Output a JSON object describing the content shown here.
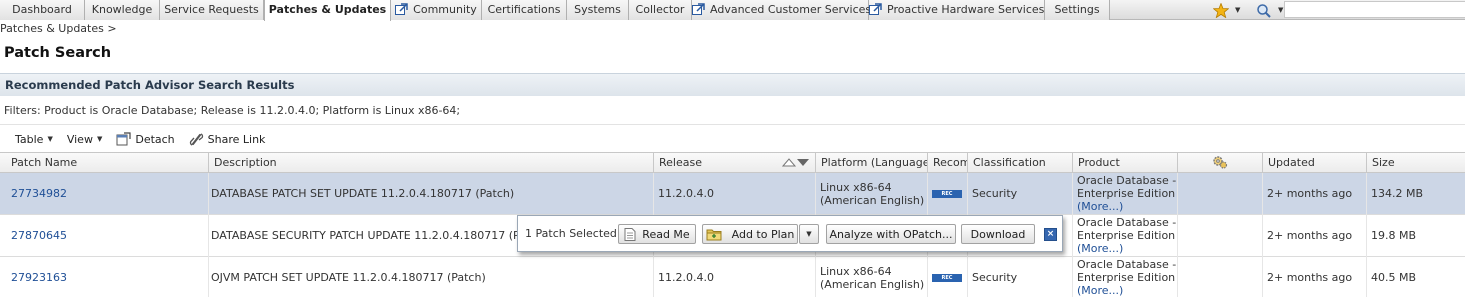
{
  "tabs": [
    {
      "label": "Dashboard",
      "external": false,
      "active": false
    },
    {
      "label": "Knowledge",
      "external": false,
      "active": false
    },
    {
      "label": "Service Requests",
      "external": false,
      "active": false
    },
    {
      "label": "Patches & Updates",
      "external": false,
      "active": true
    },
    {
      "label": "Community",
      "external": true,
      "active": false
    },
    {
      "label": "Certifications",
      "external": false,
      "active": false
    },
    {
      "label": "Systems",
      "external": false,
      "active": false
    },
    {
      "label": "Collector",
      "external": false,
      "active": false
    },
    {
      "label": "Advanced Customer Services",
      "external": true,
      "active": false
    },
    {
      "label": "Proactive Hardware Services",
      "external": true,
      "active": false
    },
    {
      "label": "Settings",
      "external": false,
      "active": false
    }
  ],
  "breadcrumb": "Patches & Updates >",
  "page_title": "Patch Search",
  "section_title": "Recommended Patch Advisor Search Results",
  "filters": "Filters: Product is Oracle Database; Release is 11.2.0.4.0; Platform is Linux x86-64;",
  "toolbar": {
    "table": "Table",
    "view": "View",
    "detach": "Detach",
    "share": "Share Link"
  },
  "columns": [
    "Patch Name",
    "Description",
    "Release",
    "Platform (Language)",
    "Recom",
    "Classification",
    "Product",
    "",
    "Updated",
    "Size"
  ],
  "rows": [
    {
      "patch": "27734982",
      "description": "DATABASE PATCH SET UPDATE 11.2.0.4.180717 (Patch)",
      "release": "11.2.0.4.0",
      "platform1": "Linux x86-64",
      "platform2": "(American English)",
      "rec": "REC",
      "classification": "Security",
      "product1": "Oracle Database -",
      "product2": "Enterprise Edition",
      "more": "(More...)",
      "updated": "2+ months ago",
      "size": "134.2 MB",
      "selected": true
    },
    {
      "patch": "27870645",
      "description": "DATABASE SECURITY PATCH UPDATE 11.2.0.4.180717 (Patch)",
      "release": "",
      "platform1": "",
      "platform2": "",
      "rec": "",
      "classification": "",
      "product1": "Oracle Database -",
      "product2": "Enterprise Edition",
      "more": "(More...)",
      "updated": "2+ months ago",
      "size": "19.8 MB",
      "selected": false
    },
    {
      "patch": "27923163",
      "description": "OJVM PATCH SET UPDATE 11.2.0.4.180717 (Patch)",
      "release": "11.2.0.4.0",
      "platform1": "Linux x86-64",
      "platform2": "(American English)",
      "rec": "REC",
      "classification": "Security",
      "product1": "Oracle Database -",
      "product2": "Enterprise Edition",
      "more": "(More...)",
      "updated": "2+ months ago",
      "size": "40.5 MB",
      "selected": false
    }
  ],
  "popup": {
    "selected_text": "1 Patch Selected",
    "read_me": "Read Me",
    "add_to_plan": "Add to Plan",
    "analyze": "Analyze with OPatch...",
    "download": "Download",
    "close": "×"
  },
  "colors": {
    "accent": "#1f4f96",
    "selected_row": "#ccd6e6",
    "rec_badge": "#2a63b0"
  },
  "icons": [
    "external-link-icon",
    "favorites-star-icon",
    "lens-icon",
    "detach-icon",
    "share-link-icon",
    "sort-icon",
    "gears-icon",
    "read-me-icon",
    "add-to-plan-icon",
    "close-icon"
  ]
}
